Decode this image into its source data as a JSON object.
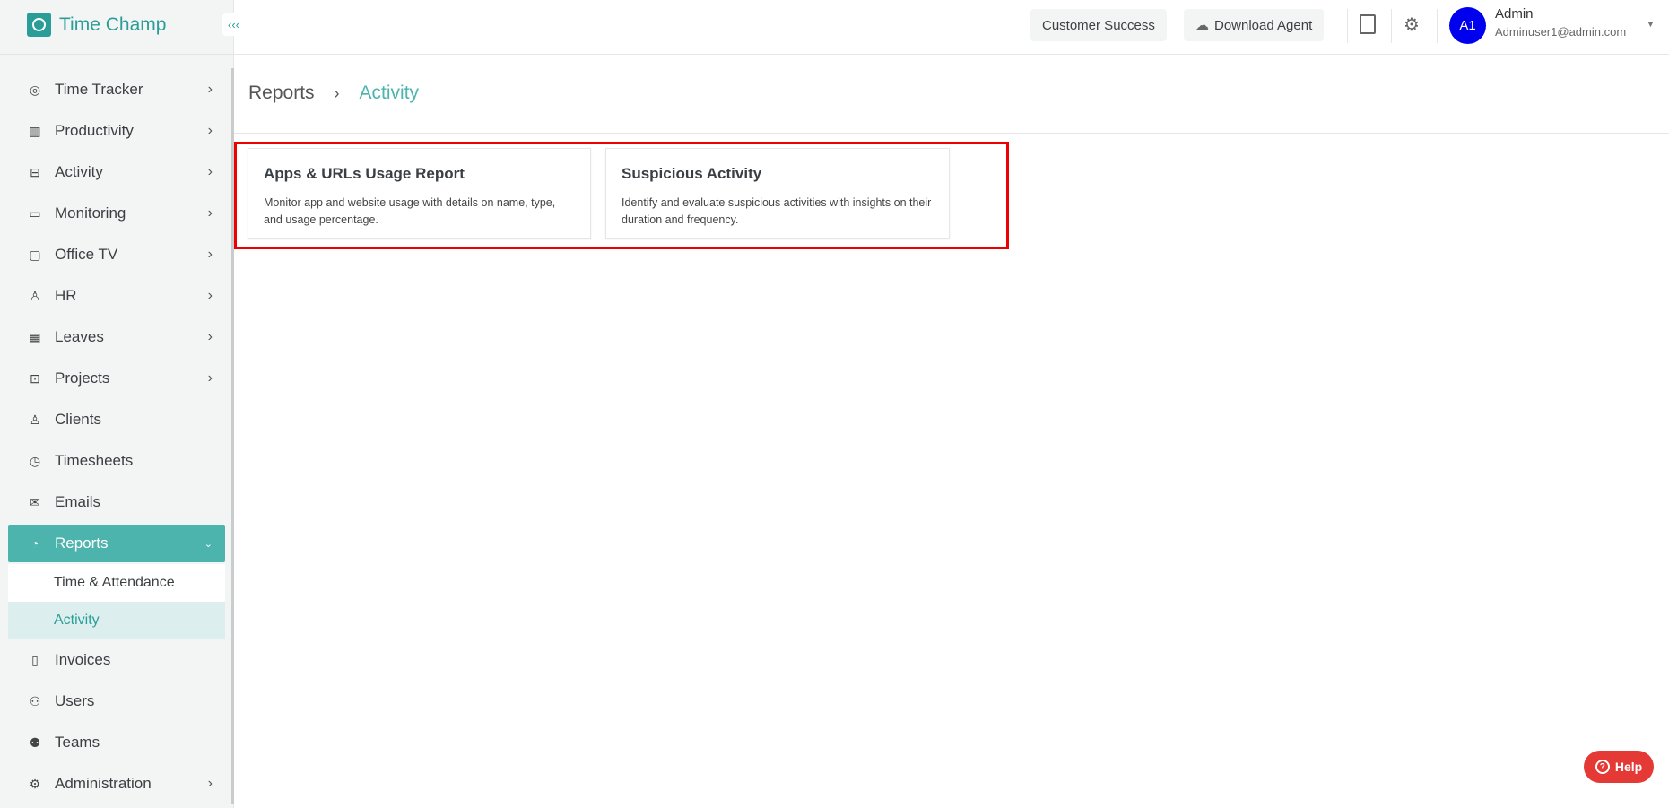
{
  "app": {
    "name": "Time Champ"
  },
  "sidebar": {
    "items": [
      {
        "label": "Time Tracker",
        "icon": "target-icon",
        "glyph": "◎",
        "chevron": true
      },
      {
        "label": "Productivity",
        "icon": "bar-chart-icon",
        "glyph": "▥",
        "chevron": true
      },
      {
        "label": "Activity",
        "icon": "ticket-icon",
        "glyph": "⊟",
        "chevron": true
      },
      {
        "label": "Monitoring",
        "icon": "monitor-icon",
        "glyph": "▭",
        "chevron": true
      },
      {
        "label": "Office TV",
        "icon": "tv-icon",
        "glyph": "▢",
        "chevron": true
      },
      {
        "label": "HR",
        "icon": "person-icon",
        "glyph": "♙",
        "chevron": true
      },
      {
        "label": "Leaves",
        "icon": "calendar-icon",
        "glyph": "▦",
        "chevron": true
      },
      {
        "label": "Projects",
        "icon": "briefcase-icon",
        "glyph": "⊡",
        "chevron": true
      },
      {
        "label": "Clients",
        "icon": "client-icon",
        "glyph": "♙",
        "chevron": false
      },
      {
        "label": "Timesheets",
        "icon": "alarm-clock-icon",
        "glyph": "◷",
        "chevron": false
      },
      {
        "label": "Emails",
        "icon": "mail-icon",
        "glyph": "✉",
        "chevron": false
      }
    ],
    "reports": {
      "label": "Reports",
      "icon": "pie-chart-icon",
      "glyph": "◔",
      "sub": [
        "Time & Attendance",
        "Activity"
      ]
    },
    "items_after": [
      {
        "label": "Invoices",
        "icon": "invoice-icon",
        "glyph": "▯",
        "chevron": false
      },
      {
        "label": "Users",
        "icon": "users-icon",
        "glyph": "⚇",
        "chevron": false
      },
      {
        "label": "Teams",
        "icon": "teams-icon",
        "glyph": "⚉",
        "chevron": false
      },
      {
        "label": "Administration",
        "icon": "gear-icon",
        "glyph": "⚙",
        "chevron": true
      }
    ]
  },
  "header": {
    "customer_success": "Customer Success",
    "download_agent": "Download Agent",
    "user": {
      "initials": "A1",
      "name": "Admin",
      "email": "Adminuser1@admin.com"
    }
  },
  "breadcrumb": {
    "parent": "Reports",
    "separator": "›",
    "current": "Activity"
  },
  "cards": [
    {
      "title": "Apps & URLs Usage Report",
      "description": "Monitor app and website usage with details on name, type, and usage percentage."
    },
    {
      "title": "Suspicious Activity",
      "description": "Identify and evaluate suspicious activities with insights on their duration and frequency."
    }
  ],
  "help": {
    "label": "Help"
  }
}
